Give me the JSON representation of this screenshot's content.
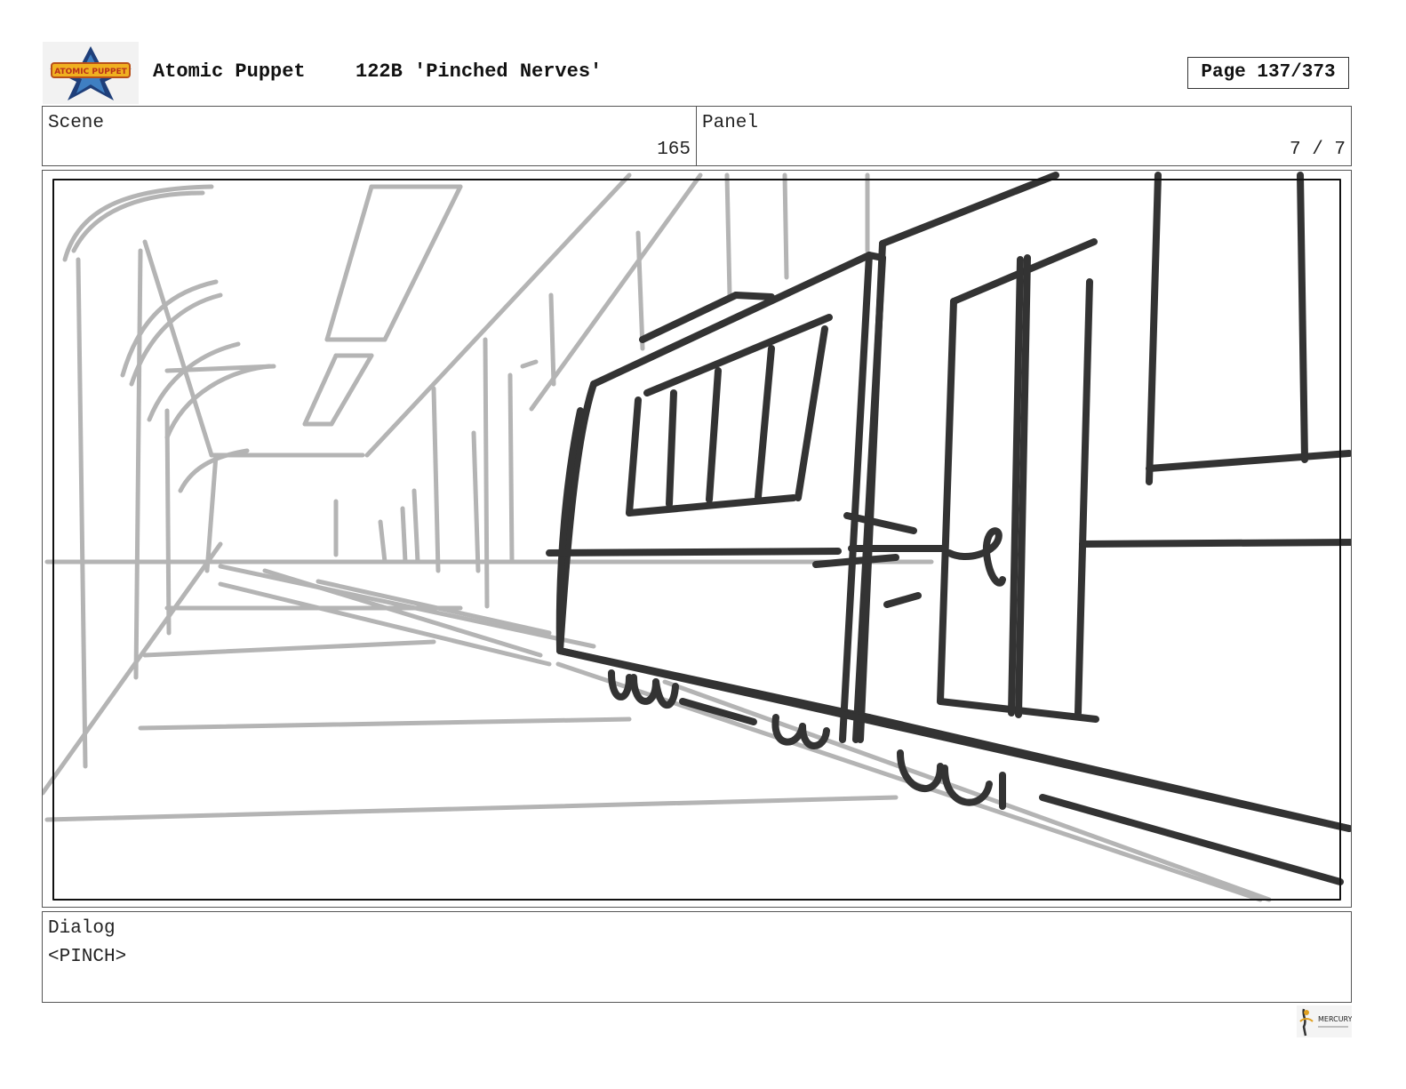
{
  "header": {
    "show_title": "Atomic Puppet",
    "episode": "122B 'Pinched Nerves'",
    "page_label": "Page 137/373",
    "logo_text": "ATOMIC PUPPET"
  },
  "info": {
    "scene_label": "Scene",
    "scene_value": "165",
    "panel_label": "Panel",
    "panel_value": "7 / 7"
  },
  "dialog": {
    "label": "Dialog",
    "text": "<PINCH>"
  },
  "footer": {
    "logo_text": "MERCURY"
  },
  "colors": {
    "sketch_light": "#b4b4b4",
    "sketch_dark": "#333333",
    "border": "#555555"
  }
}
